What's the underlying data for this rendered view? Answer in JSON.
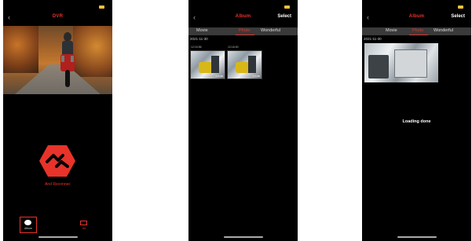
{
  "screen1": {
    "title": "DVR",
    "connect_label": "And Reconnec",
    "nav": {
      "album_label": "Album",
      "record_label": "rec"
    }
  },
  "screen2": {
    "title": "Album",
    "select_label": "Select",
    "tabs": [
      "Movie",
      "Photo",
      "Wonderful"
    ],
    "active_tab": "Photo",
    "date": "2021-11-30",
    "items": [
      {
        "time": "12:15:56",
        "size": "4.5 MB"
      },
      {
        "time": "12:16:00",
        "size": "4.5 MB"
      }
    ]
  },
  "screen3": {
    "title": "Album",
    "select_label": "Select",
    "tabs": [
      "Movie",
      "Photo",
      "Wonderful"
    ],
    "active_tab": "Photo",
    "date": "2021-11-30",
    "loading_text": "Loading done"
  },
  "colors": {
    "accent": "#e8332a",
    "background": "#000000",
    "battery": "#f0c23a"
  }
}
